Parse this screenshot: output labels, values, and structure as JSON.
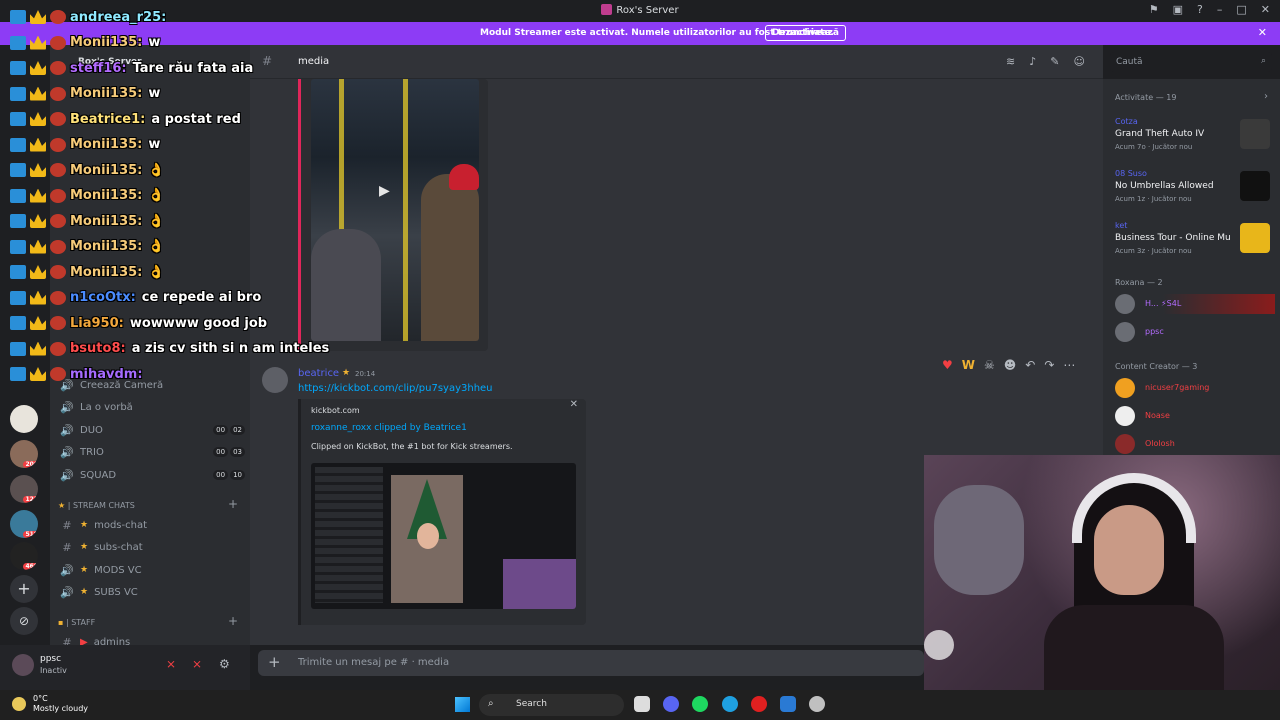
{
  "window": {
    "title": "Rox's Server"
  },
  "banner": {
    "message": "Modul Streamer este activat. Numele utilizatorilor au fost trunchiate.",
    "button": "Dezactivează"
  },
  "sidebar": {
    "server_name": "Rox's Server",
    "channels": [
      {
        "label": "DUO",
        "counts": [
          "00",
          "02"
        ]
      },
      {
        "label": "TRIO",
        "counts": [
          "00",
          "03"
        ]
      },
      {
        "label": "SQUAD",
        "counts": [
          "00",
          "10"
        ]
      }
    ],
    "voice_lounge": [
      "Creează Cameră",
      "La o vorbă"
    ],
    "stream_category": "| STREAM CHATS",
    "stream_channels": [
      "mods-chat",
      "subs-chat",
      "MODS VC",
      "SUBS VC"
    ],
    "staff_category": "| STAFF",
    "staff_channels": [
      "admins"
    ]
  },
  "rail": {
    "badges": [
      "206",
      "121",
      "518",
      "460"
    ]
  },
  "user_panel": {
    "name": "ppsc",
    "status": "Inactiv"
  },
  "chat": {
    "channel_name": "media",
    "search_placeholder": "Caută",
    "message": {
      "author": "beatrice",
      "time": "20:14",
      "link": "https://kickbot.com/clip/pu7syay3hheu",
      "embed": {
        "provider": "kickbot.com",
        "title": "roxanne_roxx clipped by Beatrice1",
        "description": "Clipped on KickBot, the #1 bot for Kick streamers."
      }
    },
    "composer_placeholder": "Trimite un mesaj pe # · media"
  },
  "activity": {
    "header": "Activitate — 19",
    "cards": [
      {
        "user": "Cotza",
        "game": "Grand Theft Auto IV",
        "meta": "Acum 7o · Jucător nou",
        "color": "#3a3a3a"
      },
      {
        "user": "08 Suso",
        "game": "No Umbrellas Allowed",
        "meta": "Acum 1z · Jucător nou",
        "color": "#111111"
      },
      {
        "user": "ket",
        "game": "Business Tour - Online Mul...",
        "meta": "Acum 3z · Jucător nou",
        "color": "#e8b61a"
      }
    ],
    "groups": [
      {
        "label": "Roxana — 2",
        "members": [
          "H... ⚡S4L",
          "ppsc"
        ]
      },
      {
        "label": "Content Creator — 3",
        "members": [
          "nicuser7gaming",
          "Noase",
          "Ololosh"
        ]
      }
    ]
  },
  "stream_chat": [
    {
      "user": "andreea_r25:",
      "text": "",
      "color": "#8fe9ff"
    },
    {
      "user": "Monii135:",
      "text": "w",
      "color": "#f6cb7a"
    },
    {
      "user": "steff16:",
      "text": "Tare rău fata aia",
      "color": "#b36cff"
    },
    {
      "user": "Monii135:",
      "text": "w",
      "color": "#f6cb7a"
    },
    {
      "user": "Beatrice1:",
      "text": "a postat red",
      "color": "#ffe27a"
    },
    {
      "user": "Monii135:",
      "text": "w",
      "color": "#f6cb7a"
    },
    {
      "user": "Monii135:",
      "text": "👌",
      "color": "#f6cb7a"
    },
    {
      "user": "Monii135:",
      "text": "👌",
      "color": "#f6cb7a"
    },
    {
      "user": "Monii135:",
      "text": "👌",
      "color": "#f6cb7a"
    },
    {
      "user": "Monii135:",
      "text": "👌",
      "color": "#f6cb7a"
    },
    {
      "user": "Monii135:",
      "text": "👌",
      "color": "#f6cb7a"
    },
    {
      "user": "n1coOtx:",
      "text": "ce repede ai bro",
      "color": "#4b8cff"
    },
    {
      "user": "Lia950:",
      "text": "wowwww good job",
      "color": "#f2a73c"
    },
    {
      "user": "bsuto8:",
      "text": "a zis cv sith si n am inteles",
      "color": "#ff4d4d"
    },
    {
      "user": "mihavdm:",
      "text": "",
      "color": "#a56bff"
    }
  ],
  "taskbar": {
    "temp": "0°C",
    "weather": "Mostly cloudy",
    "search": "Search"
  }
}
